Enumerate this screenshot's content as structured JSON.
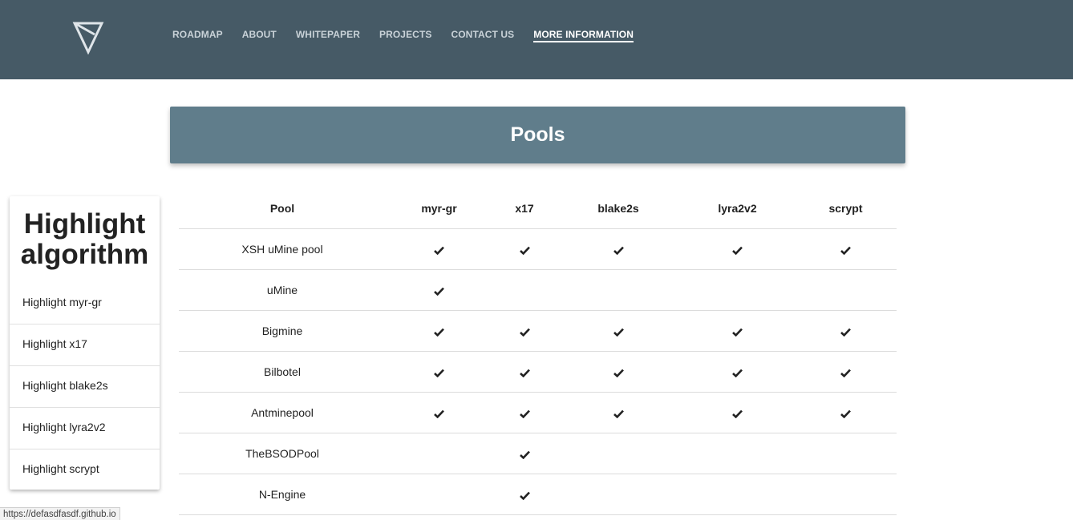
{
  "nav": {
    "items": [
      {
        "label": "ROADMAP",
        "active": false
      },
      {
        "label": "ABOUT",
        "active": false
      },
      {
        "label": "WHITEPAPER",
        "active": false
      },
      {
        "label": "PROJECTS",
        "active": false
      },
      {
        "label": "CONTACT US",
        "active": false
      },
      {
        "label": "MORE INFORMATION",
        "active": true
      }
    ]
  },
  "logo": {
    "icon": "triangle-v-logo-icon"
  },
  "header": {
    "title": "Pools"
  },
  "sidebar": {
    "title": "Highlight algorithm",
    "items": [
      {
        "label": "Highlight myr-gr"
      },
      {
        "label": "Highlight x17"
      },
      {
        "label": "Highlight blake2s"
      },
      {
        "label": "Highlight lyra2v2"
      },
      {
        "label": "Highlight scrypt"
      }
    ]
  },
  "table": {
    "columns": [
      "Pool",
      "myr-gr",
      "x17",
      "blake2s",
      "lyra2v2",
      "scrypt"
    ],
    "rows": [
      {
        "pool": "XSH uMine pool",
        "support": [
          true,
          true,
          true,
          true,
          true
        ]
      },
      {
        "pool": "uMine",
        "support": [
          true,
          false,
          false,
          false,
          false
        ]
      },
      {
        "pool": "Bigmine",
        "support": [
          true,
          true,
          true,
          true,
          true
        ]
      },
      {
        "pool": "Bilbotel",
        "support": [
          true,
          true,
          true,
          true,
          true
        ]
      },
      {
        "pool": "Antminepool",
        "support": [
          true,
          true,
          true,
          true,
          true
        ]
      },
      {
        "pool": "TheBSODPool",
        "support": [
          false,
          true,
          false,
          false,
          false
        ]
      },
      {
        "pool": "N-Engine",
        "support": [
          false,
          true,
          false,
          false,
          false
        ]
      }
    ],
    "check_icon": "check-icon"
  },
  "status_bar": {
    "url": "https://defasdfasdf.github.io"
  },
  "colors": {
    "topbar": "#465a66",
    "header_card": "#607d8b",
    "nav_text": "#c9d2d8",
    "nav_active": "#ffffff"
  }
}
